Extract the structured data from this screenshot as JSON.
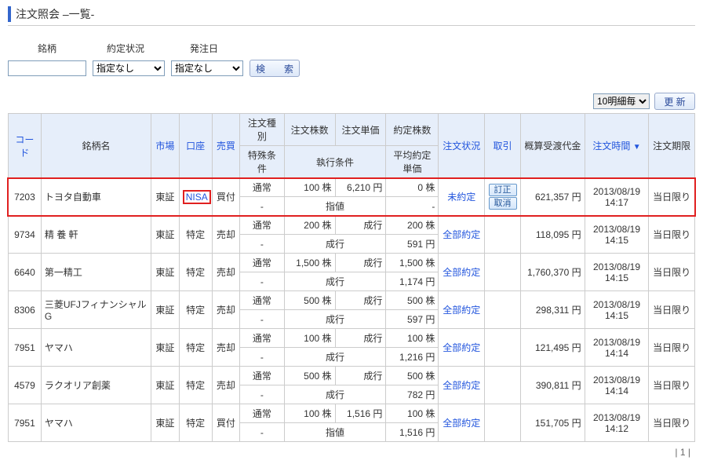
{
  "title": "注文照会 –一覧-",
  "filters": {
    "label_stock": "銘柄",
    "label_status": "約定状況",
    "label_date": "発注日",
    "select_unspecified": "指定なし",
    "search_label": "検　索"
  },
  "top": {
    "per_page": "10明細毎",
    "update": "更 新"
  },
  "header": {
    "code": "コード",
    "name": "銘柄名",
    "market": "市場",
    "account": "口座",
    "side": "売買",
    "order_type": "注文種別",
    "special_cond": "特殊条件",
    "qty": "注文株数",
    "price": "注文単価",
    "exec_cond": "執行条件",
    "filled_qty": "約定株数",
    "avg_price": "平均約定単価",
    "status": "注文状況",
    "action": "取引",
    "est_amount": "概算受渡代金",
    "order_time": "注文時間",
    "expiry": "注文期限"
  },
  "actions": {
    "edit": "訂正",
    "cancel": "取消"
  },
  "rows": [
    {
      "code": "7203",
      "name": "トヨタ自動車",
      "market": "東証",
      "account": "NISA",
      "side": "買付",
      "type": "通常",
      "cond": "-",
      "qty": "100 株",
      "price": "6,210 円",
      "exec": "指値",
      "filled": "0 株",
      "avg": "-",
      "status": "未約定",
      "show_actions": true,
      "amount": "621,357 円",
      "time1": "2013/08/19",
      "time2": "14:17",
      "expiry": "当日限り",
      "highlight": true
    },
    {
      "code": "9734",
      "name": "精 養 軒",
      "market": "東証",
      "account": "特定",
      "side": "売却",
      "type": "通常",
      "cond": "-",
      "qty": "200 株",
      "price": "成行",
      "exec": "成行",
      "filled": "200 株",
      "avg": "591 円",
      "status": "全部約定",
      "show_actions": false,
      "amount": "118,095 円",
      "time1": "2013/08/19",
      "time2": "14:15",
      "expiry": "当日限り"
    },
    {
      "code": "6640",
      "name": "第一精工",
      "market": "東証",
      "account": "特定",
      "side": "売却",
      "type": "通常",
      "cond": "-",
      "qty": "1,500 株",
      "price": "成行",
      "exec": "成行",
      "filled": "1,500 株",
      "avg": "1,174 円",
      "status": "全部約定",
      "show_actions": false,
      "amount": "1,760,370 円",
      "time1": "2013/08/19",
      "time2": "14:15",
      "expiry": "当日限り"
    },
    {
      "code": "8306",
      "name": "三菱UFJフィナンシャルG",
      "market": "東証",
      "account": "特定",
      "side": "売却",
      "type": "通常",
      "cond": "-",
      "qty": "500 株",
      "price": "成行",
      "exec": "成行",
      "filled": "500 株",
      "avg": "597 円",
      "status": "全部約定",
      "show_actions": false,
      "amount": "298,311 円",
      "time1": "2013/08/19",
      "time2": "14:15",
      "expiry": "当日限り"
    },
    {
      "code": "7951",
      "name": "ヤマハ",
      "market": "東証",
      "account": "特定",
      "side": "売却",
      "type": "通常",
      "cond": "-",
      "qty": "100 株",
      "price": "成行",
      "exec": "成行",
      "filled": "100 株",
      "avg": "1,216 円",
      "status": "全部約定",
      "show_actions": false,
      "amount": "121,495 円",
      "time1": "2013/08/19",
      "time2": "14:14",
      "expiry": "当日限り"
    },
    {
      "code": "4579",
      "name": "ラクオリア創薬",
      "market": "東証",
      "account": "特定",
      "side": "売却",
      "type": "通常",
      "cond": "-",
      "qty": "500 株",
      "price": "成行",
      "exec": "成行",
      "filled": "500 株",
      "avg": "782 円",
      "status": "全部約定",
      "show_actions": false,
      "amount": "390,811 円",
      "time1": "2013/08/19",
      "time2": "14:14",
      "expiry": "当日限り"
    },
    {
      "code": "7951",
      "name": "ヤマハ",
      "market": "東証",
      "account": "特定",
      "side": "買付",
      "type": "通常",
      "cond": "-",
      "qty": "100 株",
      "price": "1,516 円",
      "exec": "指値",
      "filled": "100 株",
      "avg": "1,516 円",
      "status": "全部約定",
      "show_actions": false,
      "amount": "151,705 円",
      "time1": "2013/08/19",
      "time2": "14:12",
      "expiry": "当日限り"
    }
  ],
  "footer": "| 1 |"
}
